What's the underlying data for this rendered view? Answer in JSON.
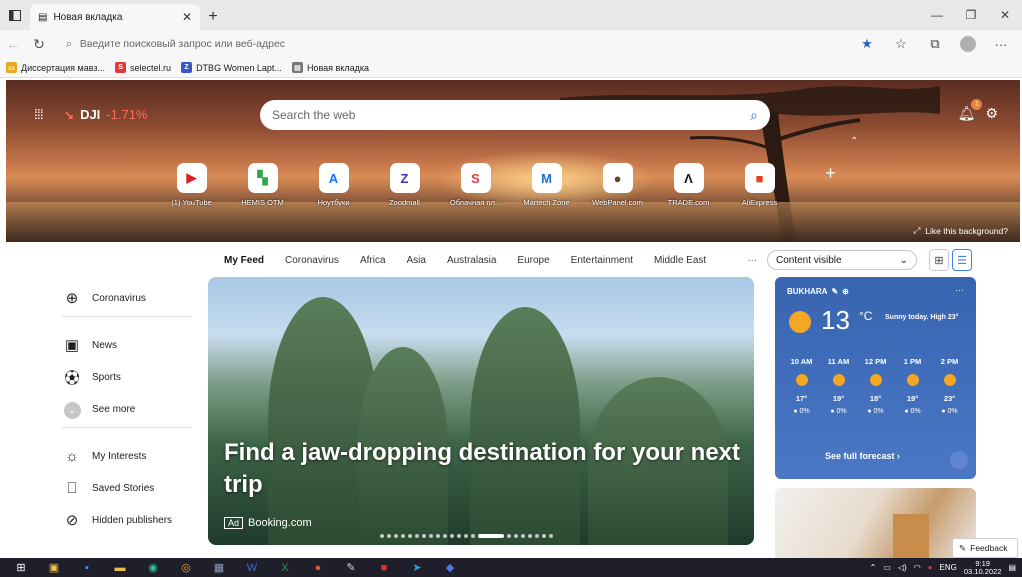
{
  "browser": {
    "tab_title": "Новая вкладка",
    "address_placeholder": "Введите поисковый запрос или веб-адрес",
    "bookmarks": [
      {
        "label": "Диссертация мавз...",
        "color": "#e8a820",
        "glyph": "▭"
      },
      {
        "label": "selectel.ru",
        "color": "#e03a3a",
        "glyph": "S"
      },
      {
        "label": "DTBG Women Lapt...",
        "color": "#3a56c8",
        "glyph": "Z"
      },
      {
        "label": "Новая вкладка",
        "color": "#777777",
        "glyph": "▤"
      }
    ]
  },
  "hero": {
    "ticker_symbol": "DJI",
    "ticker_change": "-1.71%",
    "search_placeholder": "Search the web",
    "notification_count": "1",
    "like_background": "Like this background?",
    "quick_links": [
      {
        "label": "(1) YouTube",
        "glyph": "▶",
        "color": "#e02020"
      },
      {
        "label": "HEMIS OTM",
        "glyph": "▚",
        "color": "#2aa84a"
      },
      {
        "label": "Ноутбуки",
        "glyph": "A",
        "color": "#1a73e8"
      },
      {
        "label": "Zoodmall",
        "glyph": "Z",
        "color": "#3a3ab0"
      },
      {
        "label": "Облачная пл...",
        "glyph": "S",
        "color": "#e03a3a"
      },
      {
        "label": "Martech Zone",
        "glyph": "M",
        "color": "#1a6fd6"
      },
      {
        "label": "WebPanel.com",
        "glyph": "●",
        "color": "#5a4a20"
      },
      {
        "label": "TRADE.com",
        "glyph": "Λ",
        "color": "#111111"
      },
      {
        "label": "AliExpress",
        "glyph": "■",
        "color": "#e8401c"
      }
    ]
  },
  "feed": {
    "tabs": [
      "My Feed",
      "Coronavirus",
      "Africa",
      "Asia",
      "Australasia",
      "Europe",
      "Entertainment",
      "Middle East"
    ],
    "more": "···",
    "content_visible": "Content visible"
  },
  "leftnav": {
    "coronavirus": "Coronavirus",
    "news": "News",
    "sports": "Sports",
    "see_more": "See more",
    "my_interests": "My Interests",
    "saved_stories": "Saved Stories",
    "hidden_publishers": "Hidden publishers"
  },
  "main_card": {
    "title": "Find a jaw-dropping destination for your next trip",
    "ad_label": "Ad",
    "source": "Booking.com"
  },
  "weather": {
    "location": "BUKHARA",
    "temperature": "13",
    "unit": "°C",
    "summary": "Sunny today. High 23°",
    "hours": [
      {
        "time": "10 AM",
        "temp": "17°",
        "precip": "● 0%"
      },
      {
        "time": "11 AM",
        "temp": "19°",
        "precip": "● 0%"
      },
      {
        "time": "12 PM",
        "temp": "18°",
        "precip": "● 0%"
      },
      {
        "time": "1 PM",
        "temp": "19°",
        "precip": "● 0%"
      },
      {
        "time": "2 PM",
        "temp": "23°",
        "precip": "● 0%"
      }
    ],
    "full_forecast": "See full forecast"
  },
  "feedback": "Feedback",
  "taskbar": {
    "lang": "ENG",
    "time": "9:19",
    "date": "03.10.2022"
  }
}
